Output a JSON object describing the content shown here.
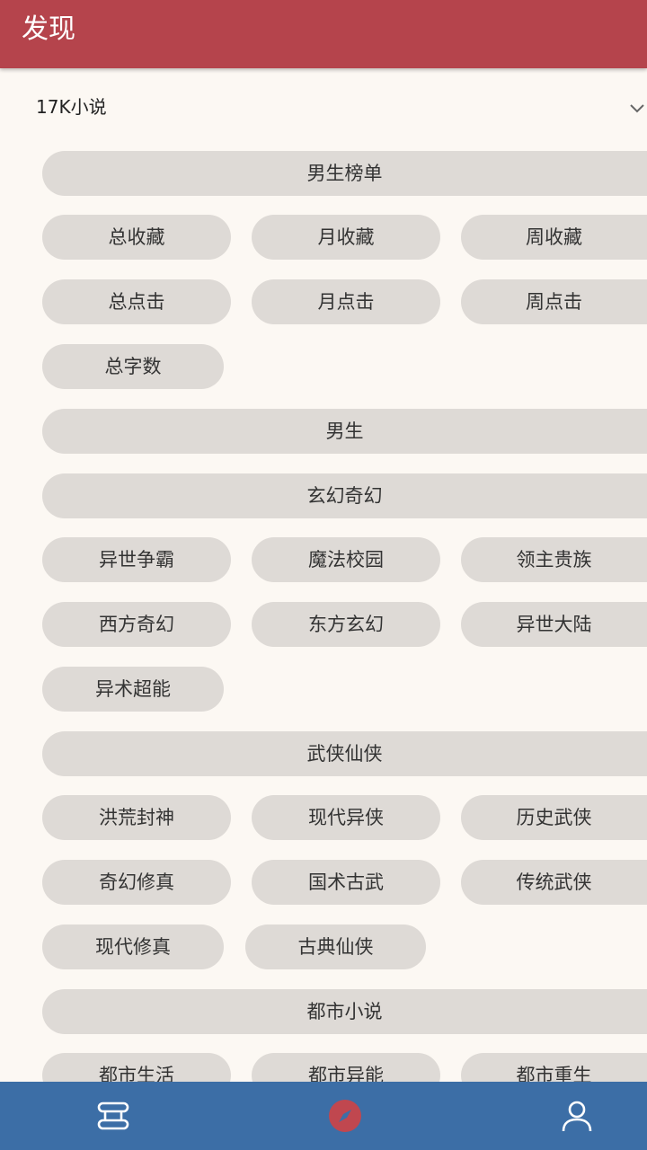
{
  "header": {
    "title": "发现"
  },
  "source": {
    "label": "17K小说"
  },
  "sections": [
    {
      "title": "男生榜单",
      "tags": [
        "总收藏",
        "月收藏",
        "周收藏",
        "总点击",
        "月点击",
        "周点击",
        "总字数"
      ]
    },
    {
      "title": "男生",
      "tags": []
    },
    {
      "title": "玄幻奇幻",
      "tags": [
        "异世争霸",
        "魔法校园",
        "领主贵族",
        "西方奇幻",
        "东方玄幻",
        "异世大陆",
        "异术超能"
      ]
    },
    {
      "title": "武侠仙侠",
      "tags": [
        "洪荒封神",
        "现代异侠",
        "历史武侠",
        "奇幻修真",
        "国术古武",
        "传统武侠",
        "现代修真",
        "古典仙侠"
      ]
    },
    {
      "title": "都市小说",
      "tags": [
        "都市生活",
        "都市异能",
        "都市重生"
      ]
    }
  ],
  "bottom_nav": [
    {
      "name": "bookshelf",
      "icon": "bookshelf-icon"
    },
    {
      "name": "discover",
      "icon": "compass-icon",
      "active": true
    },
    {
      "name": "profile",
      "icon": "person-icon"
    }
  ],
  "colors": {
    "header": "#b5444c",
    "background": "#fcf8f3",
    "chip": "#dedad6",
    "bottom_nav": "#3c6ea6",
    "active_icon": "#c0474f"
  }
}
